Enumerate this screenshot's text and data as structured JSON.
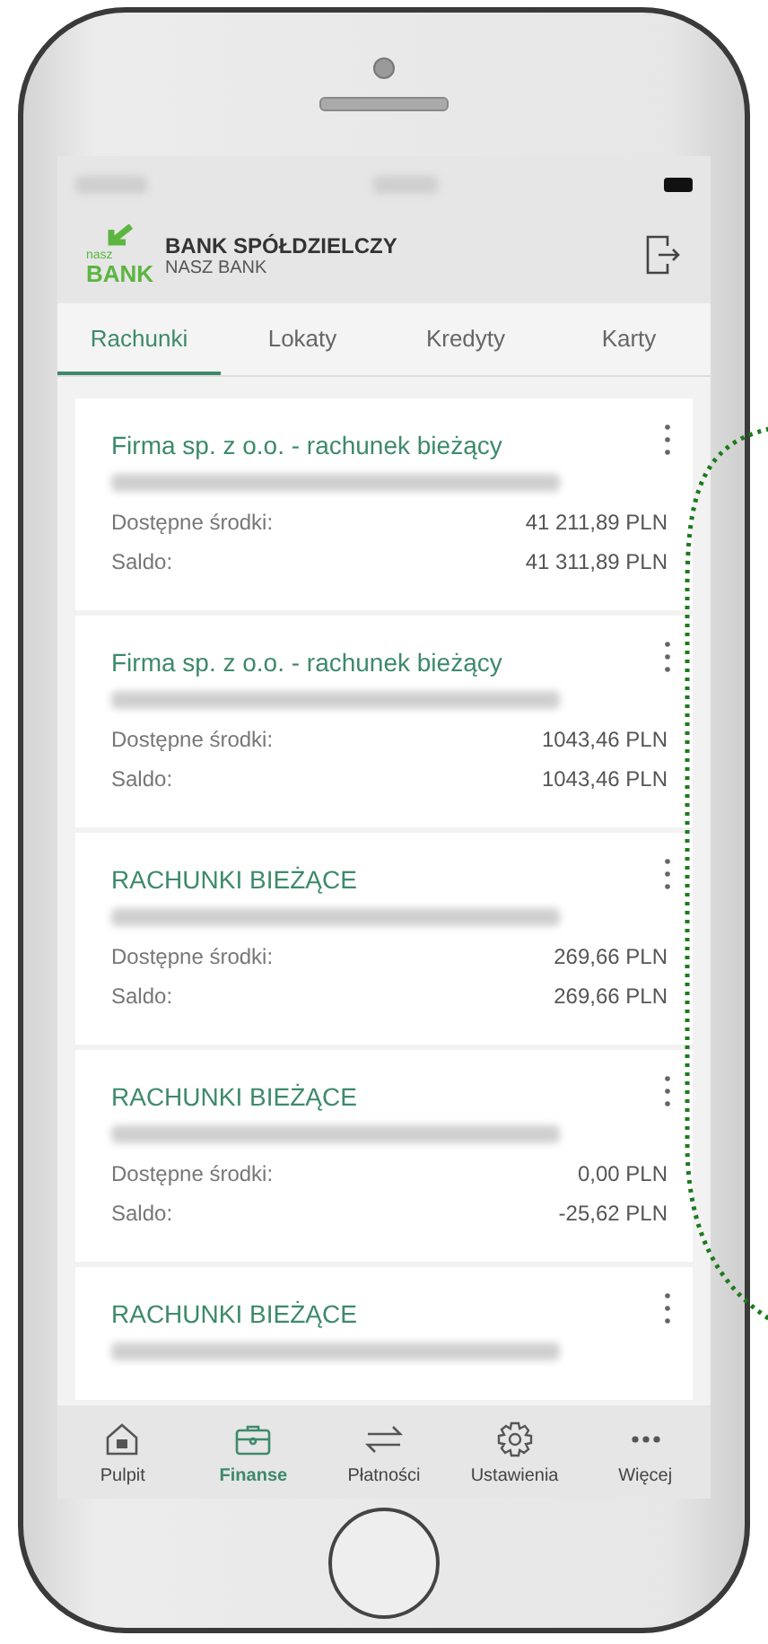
{
  "header": {
    "logo_small": "nasz",
    "logo_big": "BANK",
    "bank_name": "BANK SPÓŁDZIELCZY",
    "bank_subname": "NASZ BANK"
  },
  "tabs": [
    {
      "label": "Rachunki",
      "selected": true
    },
    {
      "label": "Lokaty",
      "selected": false
    },
    {
      "label": "Kredyty",
      "selected": false
    },
    {
      "label": "Karty",
      "selected": false
    }
  ],
  "accounts": [
    {
      "title": "Firma sp. z o.o. - rachunek bieżący",
      "rows": [
        {
          "label": "Dostępne środki:",
          "value": "41 211,89 PLN"
        },
        {
          "label": "Saldo:",
          "value": "41 311,89 PLN"
        }
      ]
    },
    {
      "title": "Firma sp. z o.o. - rachunek bieżący",
      "rows": [
        {
          "label": "Dostępne środki:",
          "value": "1043,46 PLN"
        },
        {
          "label": "Saldo:",
          "value": "1043,46 PLN"
        }
      ]
    },
    {
      "title": "RACHUNKI BIEŻĄCE",
      "rows": [
        {
          "label": "Dostępne środki:",
          "value": "269,66 PLN"
        },
        {
          "label": "Saldo:",
          "value": "269,66 PLN"
        }
      ]
    },
    {
      "title": "RACHUNKI BIEŻĄCE",
      "rows": [
        {
          "label": "Dostępne środki:",
          "value": "0,00 PLN"
        },
        {
          "label": "Saldo:",
          "value": "-25,62 PLN"
        }
      ]
    },
    {
      "title": "RACHUNKI BIEŻĄCE"
    }
  ],
  "nav": [
    {
      "kind": "home",
      "label": "Pulpit",
      "selected": false
    },
    {
      "kind": "briefcase",
      "label": "Finanse",
      "selected": true
    },
    {
      "kind": "transfer",
      "label": "Płatności",
      "selected": false
    },
    {
      "kind": "gear",
      "label": "Ustawienia",
      "selected": false
    },
    {
      "kind": "more",
      "label": "Więcej",
      "selected": false
    }
  ]
}
